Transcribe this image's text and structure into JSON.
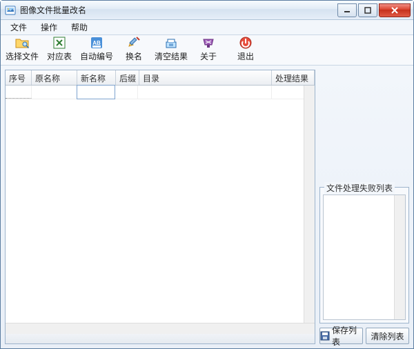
{
  "window": {
    "title": "图像文件批量改名"
  },
  "menu": {
    "file": "文件",
    "operate": "操作",
    "help": "帮助"
  },
  "toolbar": {
    "select_files": "选择文件",
    "mapping_table": "对应表",
    "auto_number": "自动编号",
    "rename": "换名",
    "clear_results": "清空结果",
    "about": "关于",
    "exit": "退出"
  },
  "columns": {
    "seq": "序号",
    "old_name": "原名称",
    "new_name": "新名称",
    "ext": "后缀",
    "dir": "目录",
    "result": "处理结果"
  },
  "rows": [
    {
      "seq": "",
      "old_name": "",
      "new_name": "",
      "ext": "",
      "dir": "",
      "result": ""
    }
  ],
  "right": {
    "fail_list_label": "文件处理失败列表",
    "save_list": "保存列表",
    "clear_list": "清除列表"
  }
}
